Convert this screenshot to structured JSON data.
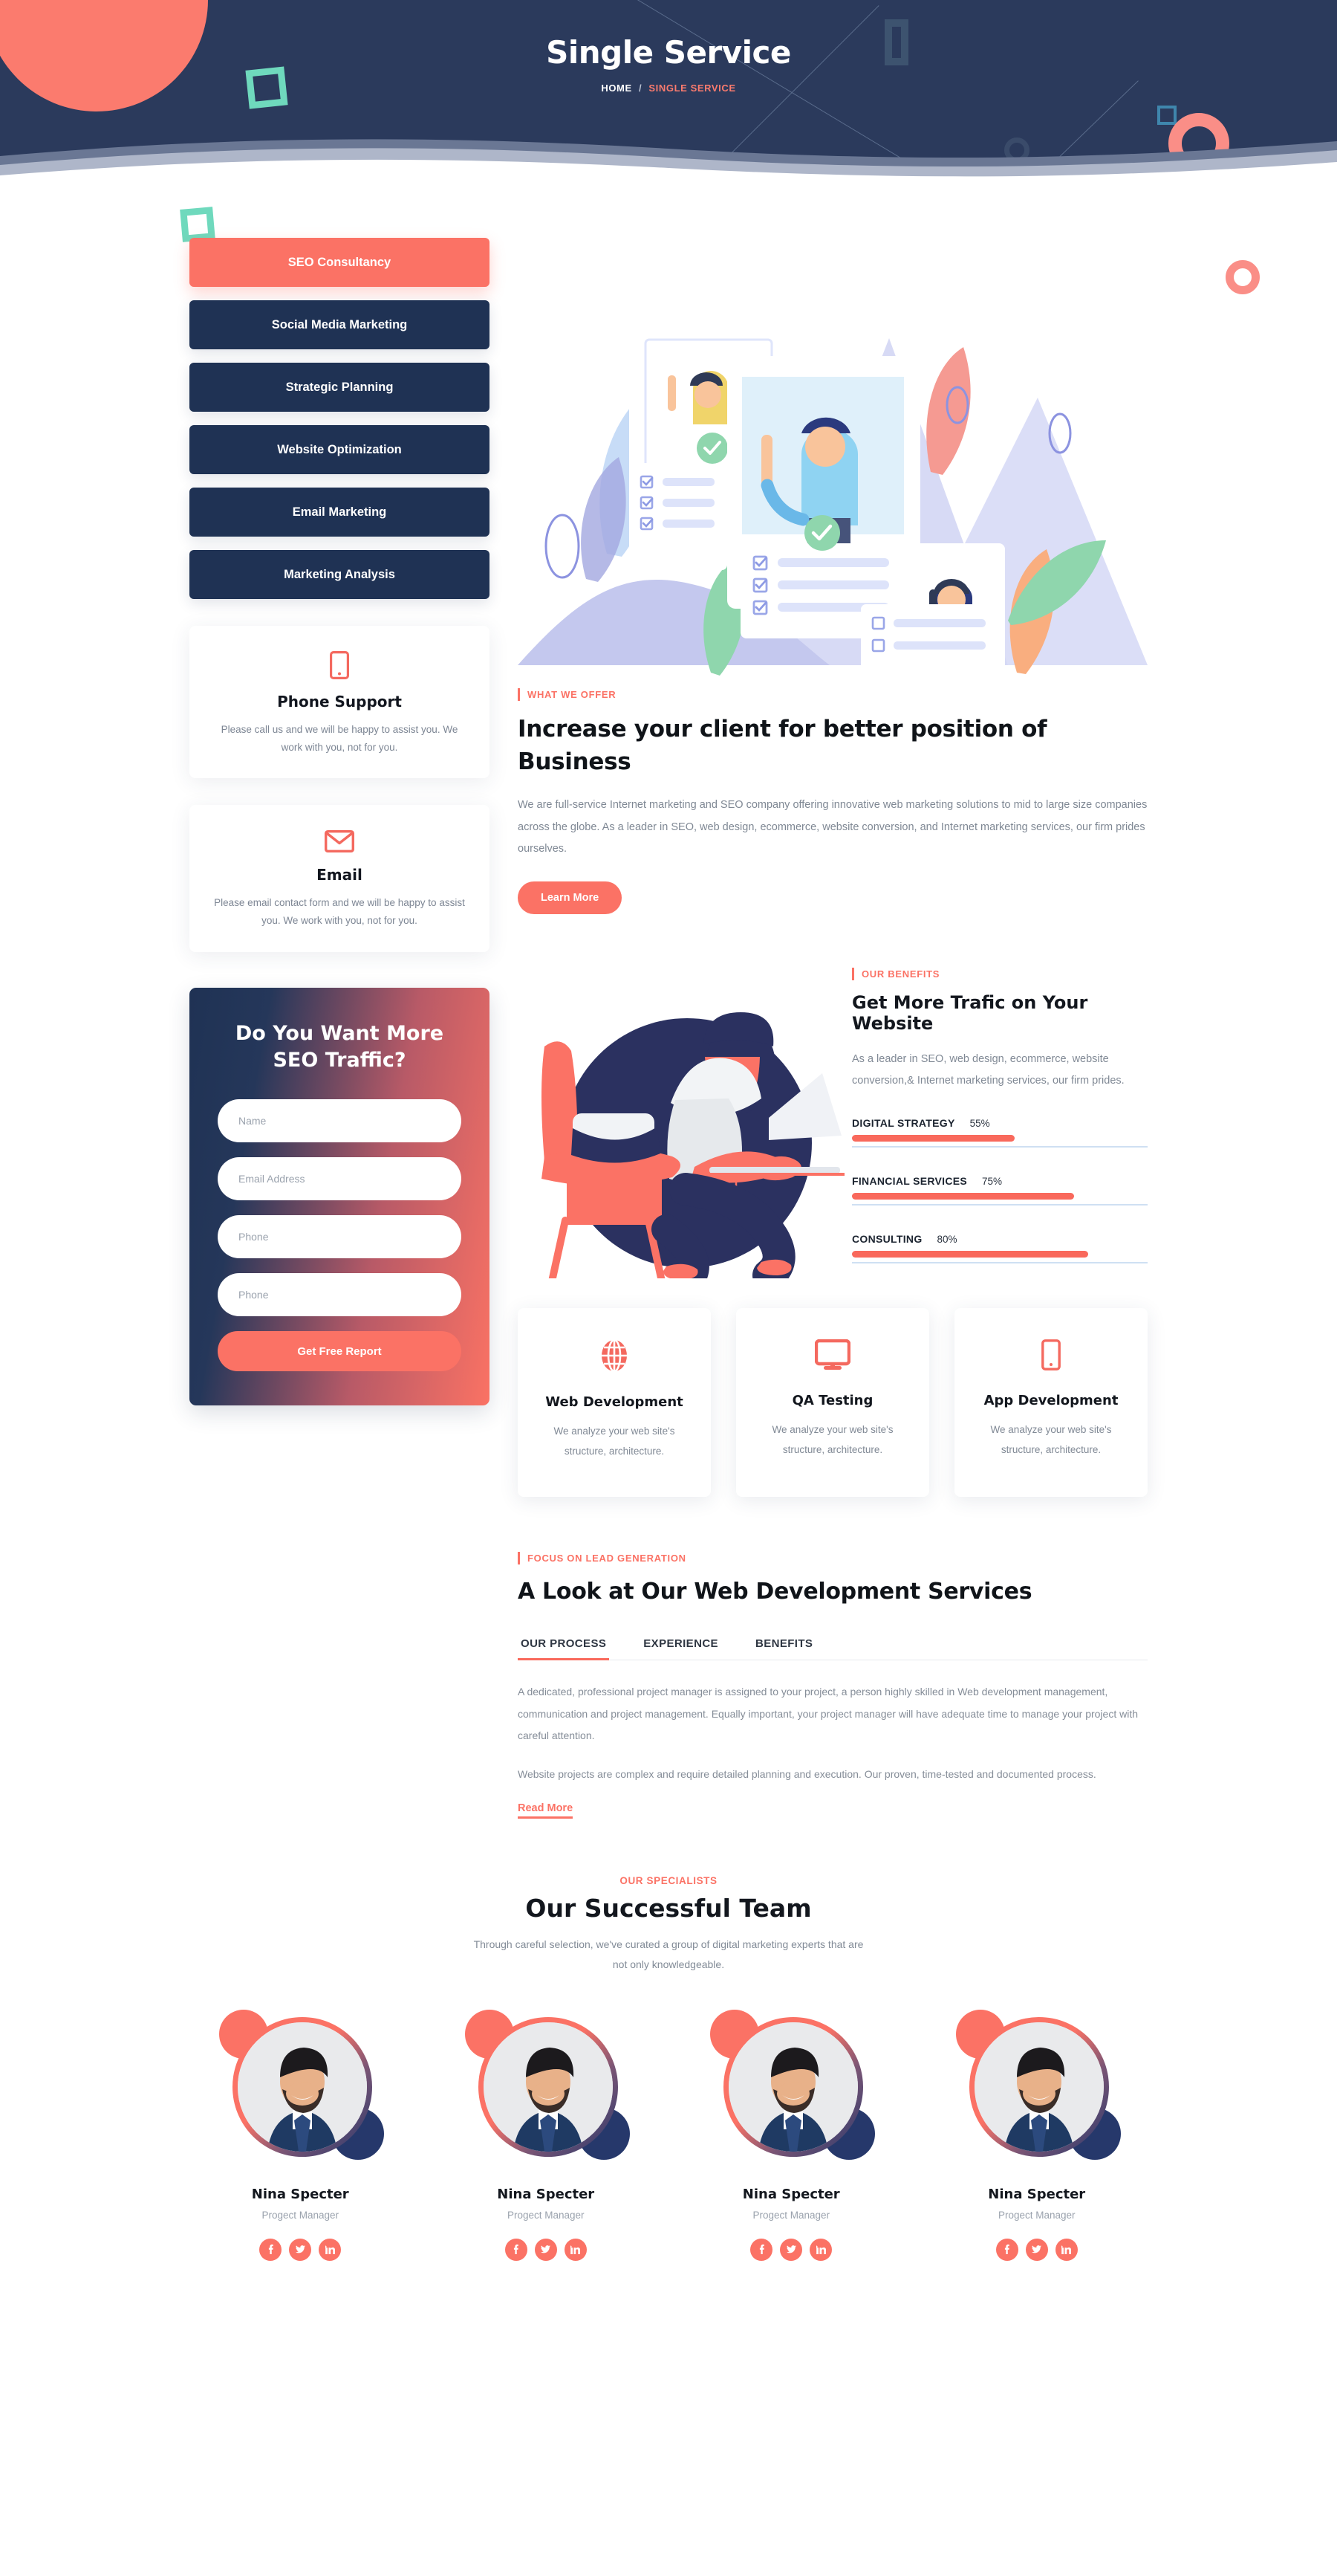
{
  "hero": {
    "title": "Single Service",
    "breadcrumb": {
      "home": "HOME",
      "separator": "/",
      "current": "SINGLE SERVICE"
    },
    "bg_color": "#2b3a5c",
    "accent_color": "#fb7265"
  },
  "sidebar": {
    "services": [
      {
        "label": "SEO Consultancy",
        "active": true
      },
      {
        "label": "Social Media Marketing",
        "active": false
      },
      {
        "label": "Strategic Planning",
        "active": false
      },
      {
        "label": "Website Optimization",
        "active": false
      },
      {
        "label": "Email Marketing",
        "active": false
      },
      {
        "label": "Marketing Analysis",
        "active": false
      }
    ],
    "contact_cards": [
      {
        "icon": "mobile-phone-icon",
        "title": "Phone Support",
        "text": "Please call us and we will be happy to assist you. We work with you, not for you."
      },
      {
        "icon": "envelope-icon",
        "title": "Email",
        "text": "Please email contact form and we will be happy to assist you. We work with you, not for you."
      }
    ],
    "cta": {
      "title": "Do You Want More SEO Traffic?",
      "fields": [
        {
          "name": "name",
          "placeholder": "Name",
          "value": ""
        },
        {
          "name": "email",
          "placeholder": "Email Address",
          "value": ""
        },
        {
          "name": "phone1",
          "placeholder": "Phone",
          "value": ""
        },
        {
          "name": "phone2",
          "placeholder": "Phone",
          "value": ""
        }
      ],
      "submit_label": "Get Free Report"
    }
  },
  "offer": {
    "eyebrow": "WHAT WE OFFER",
    "heading": "Increase your client for better position of Business",
    "paragraph": "We are full-service Internet marketing and SEO company offering innovative web marketing solutions to mid to large size companies across the globe. As a leader in SEO, web design, ecommerce, website conversion, and Internet marketing services, our firm prides ourselves.",
    "button_label": "Learn More"
  },
  "benefits": {
    "eyebrow": "OUR BENEFITS",
    "heading": "Get More Trafic on Your Website",
    "paragraph": "As a leader in SEO, web design, ecommerce, website conversion,& Internet marketing services, our firm prides."
  },
  "chart_data": {
    "type": "bar",
    "title": "Get More Trafic on Your Website",
    "orientation": "horizontal",
    "categories": [
      "DIGITAL STRATEGY",
      "FINANCIAL SERVICES",
      "CONSULTING"
    ],
    "values": [
      55,
      75,
      80
    ],
    "value_labels": [
      "55%",
      "75%",
      "80%"
    ],
    "xlabel": "",
    "ylabel": "",
    "xlim": [
      0,
      100
    ],
    "grid": false,
    "legend": "none",
    "bar_color": "#f9695c",
    "track_color": "#cfe0f3"
  },
  "service_cards": [
    {
      "icon": "globe-icon",
      "title": "Web Development",
      "text": "We analyze your web site's structure, architecture."
    },
    {
      "icon": "monitor-icon",
      "title": "QA Testing",
      "text": "We analyze your web site's structure, architecture."
    },
    {
      "icon": "mobile-phone-icon",
      "title": "App Development",
      "text": "We analyze your web site's structure, architecture."
    }
  ],
  "lead": {
    "eyebrow": "FOCUS ON LEAD GENERATION",
    "heading": "A Look at Our Web Development Services",
    "tabs": [
      {
        "label": "OUR PROCESS",
        "active": true
      },
      {
        "label": "EXPERIENCE",
        "active": false
      },
      {
        "label": "BENEFITS",
        "active": false
      }
    ],
    "paragraph1": "A dedicated, professional project manager is assigned to your project, a person highly skilled in Web development management, communication and project management. Equally important, your project manager will have adequate time to manage your project with careful attention.",
    "paragraph2": "Website projects are complex and require detailed planning and execution. Our proven, time-tested and documented process.",
    "read_more": "Read More"
  },
  "team": {
    "eyebrow": "OUR SPECIALISTS",
    "heading": "Our Successful Team",
    "subtitle": "Through careful selection, we've curated a group of digital marketing experts that are not only knowledgeable.",
    "members": [
      {
        "name": "Nina Specter",
        "role": "Progect Manager",
        "socials": [
          "facebook-icon",
          "twitter-icon",
          "linkedin-icon"
        ]
      },
      {
        "name": "Nina Specter",
        "role": "Progect Manager",
        "socials": [
          "facebook-icon",
          "twitter-icon",
          "linkedin-icon"
        ]
      },
      {
        "name": "Nina Specter",
        "role": "Progect Manager",
        "socials": [
          "facebook-icon",
          "twitter-icon",
          "linkedin-icon"
        ]
      },
      {
        "name": "Nina Specter",
        "role": "Progect Manager",
        "socials": [
          "facebook-icon",
          "twitter-icon",
          "linkedin-icon"
        ]
      }
    ]
  }
}
